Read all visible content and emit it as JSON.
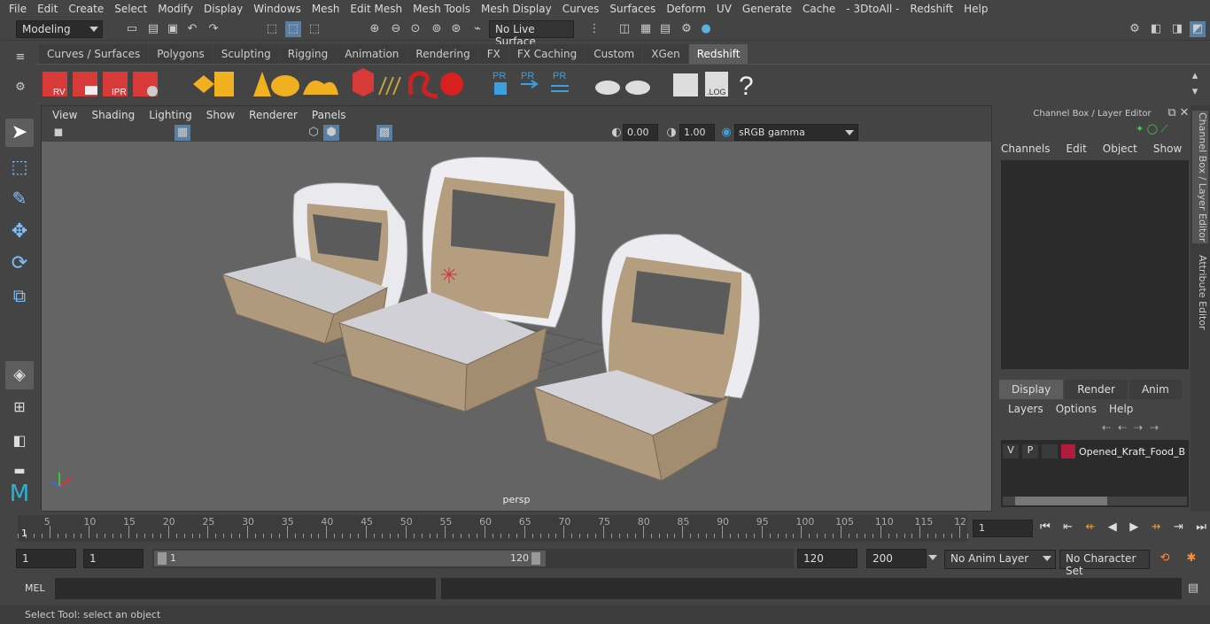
{
  "menus": [
    "File",
    "Edit",
    "Create",
    "Select",
    "Modify",
    "Display",
    "Windows",
    "Mesh",
    "Edit Mesh",
    "Mesh Tools",
    "Mesh Display",
    "Curves",
    "Surfaces",
    "Deform",
    "UV",
    "Generate",
    "Cache",
    "- 3DtoAll -",
    "Redshift",
    "Help"
  ],
  "status": {
    "mode": "Modeling",
    "live_surface": "No Live Surface"
  },
  "shelf_tabs": [
    "Curves / Surfaces",
    "Polygons",
    "Sculpting",
    "Rigging",
    "Animation",
    "Rendering",
    "FX",
    "FX Caching",
    "Custom",
    "XGen",
    "Redshift"
  ],
  "active_shelf": "Redshift",
  "shelf_labels": {
    "rv": "RV",
    "ipr": "IPR",
    "pr": "PR",
    "log": ".LOG",
    "help": "?"
  },
  "viewport": {
    "menus": [
      "View",
      "Shading",
      "Lighting",
      "Show",
      "Renderer",
      "Panels"
    ],
    "exposure": "0.00",
    "gamma": "1.00",
    "color_space": "sRGB gamma",
    "camera": "persp"
  },
  "channel_box": {
    "title": "Channel Box / Layer Editor",
    "menus": [
      "Channels",
      "Edit",
      "Object",
      "Show"
    ]
  },
  "layer_editor": {
    "tabs": [
      "Display",
      "Render",
      "Anim"
    ],
    "active_tab": "Display",
    "menus": [
      "Layers",
      "Options",
      "Help"
    ],
    "layer": {
      "v": "V",
      "p": "P",
      "name": "Opened_Kraft_Food_B",
      "color": "#b01c3a"
    }
  },
  "side_tabs": [
    "Channel Box / Layer Editor",
    "Attribute Editor"
  ],
  "timeline": {
    "ticks": [
      5,
      10,
      15,
      20,
      25,
      30,
      35,
      40,
      45,
      50,
      55,
      60,
      65,
      70,
      75,
      80,
      85,
      90,
      95,
      100,
      105,
      110,
      115,
      12
    ],
    "current": "1",
    "frame_field": "1"
  },
  "range": {
    "start": "1",
    "playback_start": "1",
    "slider_start": "1",
    "slider_end": "120",
    "playback_end": "120",
    "end": "200",
    "anim_layer": "No Anim Layer",
    "char_set": "No Character Set"
  },
  "mel": {
    "label": "MEL"
  },
  "help_line": "Select Tool: select an object"
}
